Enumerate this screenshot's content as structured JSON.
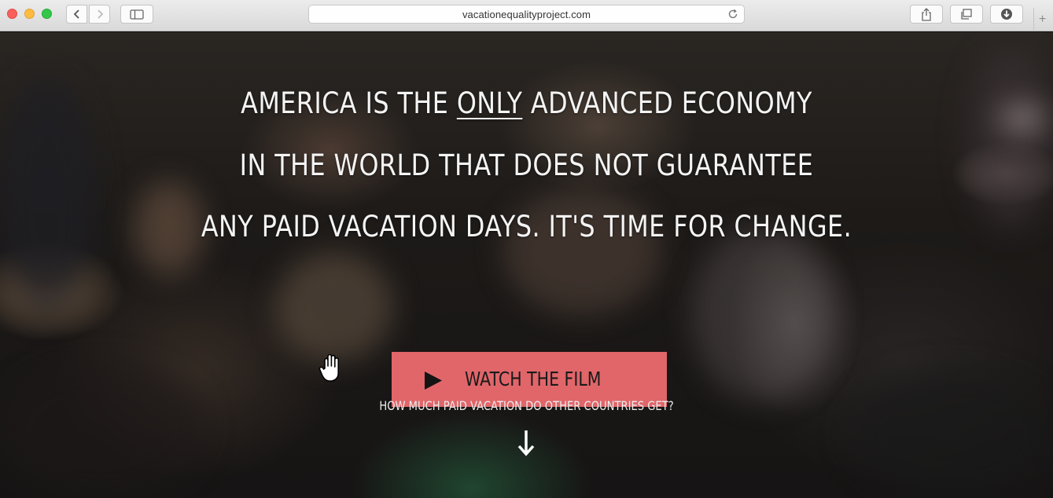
{
  "browser": {
    "url": "vacationequalityproject.com",
    "new_tab_symbol": "+"
  },
  "hero": {
    "line1_before": "AMERICA IS THE ",
    "line1_emphasis": "ONLY",
    "line1_after": " ADVANCED ECONOMY",
    "line2": "IN THE WORLD THAT DOES NOT GUARANTEE",
    "line3": "ANY PAID VACATION DAYS. IT'S TIME FOR CHANGE.",
    "cta_label": "WATCH THE FILM",
    "cta_icon": "play-icon",
    "question": "HOW MUCH PAID VACATION DO OTHER COUNTRIES GET?",
    "scroll_icon": "arrow-down-icon",
    "cursor_icon": "hand-pointer-icon"
  },
  "colors": {
    "cta_background": "#e0666a",
    "headline_text": "#f4f4f4"
  }
}
